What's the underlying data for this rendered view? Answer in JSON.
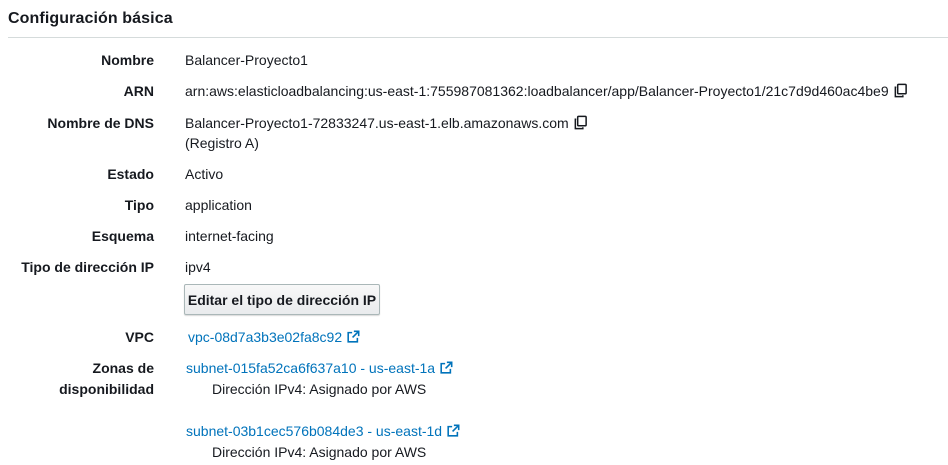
{
  "section": {
    "title": "Configuración básica"
  },
  "fields": {
    "nombre": {
      "label": "Nombre",
      "value": "Balancer-Proyecto1"
    },
    "arn": {
      "label": "ARN",
      "value": "arn:aws:elasticloadbalancing:us-east-1:755987081362:loadbalancer/app/Balancer-Proyecto1/21c7d9d460ac4be9",
      "copy_icon": "copy-icon"
    },
    "dns": {
      "label": "Nombre de DNS",
      "value": "Balancer-Proyecto1-72833247.us-east-1.elb.amazonaws.com",
      "note": "(Registro A)",
      "copy_icon": "copy-icon"
    },
    "estado": {
      "label": "Estado",
      "value": "Activo"
    },
    "tipo": {
      "label": "Tipo",
      "value": "application"
    },
    "esquema": {
      "label": "Esquema",
      "value": "internet-facing"
    },
    "tipo_ip": {
      "label": "Tipo de dirección IP",
      "value": "ipv4",
      "button_label": "Editar el tipo de dirección IP"
    },
    "vpc": {
      "label": "VPC",
      "link": "vpc-08d7a3b3e02fa8c92",
      "icon": "external-link-icon"
    },
    "zonas": {
      "label_line1": "Zonas de",
      "label_line2": "disponibilidad",
      "subnets": [
        {
          "link": "subnet-015fa52ca6f637a10 - us-east-1a",
          "detail": "Dirección IPv4: Asignado por AWS"
        },
        {
          "link": "subnet-03b1cec576b084de3 - us-east-1d",
          "detail": "Dirección IPv4: Asignado por AWS"
        }
      ]
    }
  },
  "colors": {
    "link": "#0073bb",
    "text": "#16191f",
    "divider": "#d5dbdb"
  }
}
